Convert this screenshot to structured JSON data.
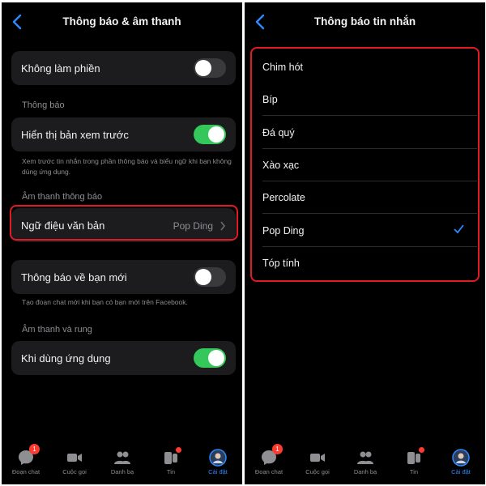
{
  "left": {
    "title": "Thông báo & âm thanh",
    "dnd_label": "Không làm phiền",
    "dnd_on": false,
    "section_notifications": "Thông báo",
    "preview_label": "Hiển thị bản xem trước",
    "preview_on": true,
    "preview_note": "Xem trước tin nhắn trong phần thông báo và biểu ngữ khi bạn không dùng ứng dụng.",
    "section_sound": "Âm thanh thông báo",
    "tone_label": "Ngữ điệu văn bản",
    "tone_value": "Pop Ding",
    "new_friend_label": "Thông báo về bạn mới",
    "new_friend_on": false,
    "new_friend_note": "Tạo đoạn chat mới khi bạn có bạn mới trên Facebook.",
    "section_vibrate": "Âm thanh và rung",
    "in_app_label": "Khi dùng ứng dụng",
    "in_app_on": true
  },
  "right": {
    "title": "Thông báo tin nhắn",
    "options": [
      "Chim hót",
      "Bíp",
      "Đá quý",
      "Xào xạc",
      "Percolate",
      "Pop Ding",
      "Tóp tính"
    ],
    "selected": "Pop Ding"
  },
  "tabbar": {
    "chats": "Đoạn chat",
    "chats_badge": "1",
    "calls": "Cuộc gọi",
    "contacts": "Danh bạ",
    "stories": "Tin",
    "settings": "Cài đặt"
  },
  "colors": {
    "accent": "#2e89ff",
    "toggle_on": "#34c759",
    "highlight": "#e01b24"
  }
}
